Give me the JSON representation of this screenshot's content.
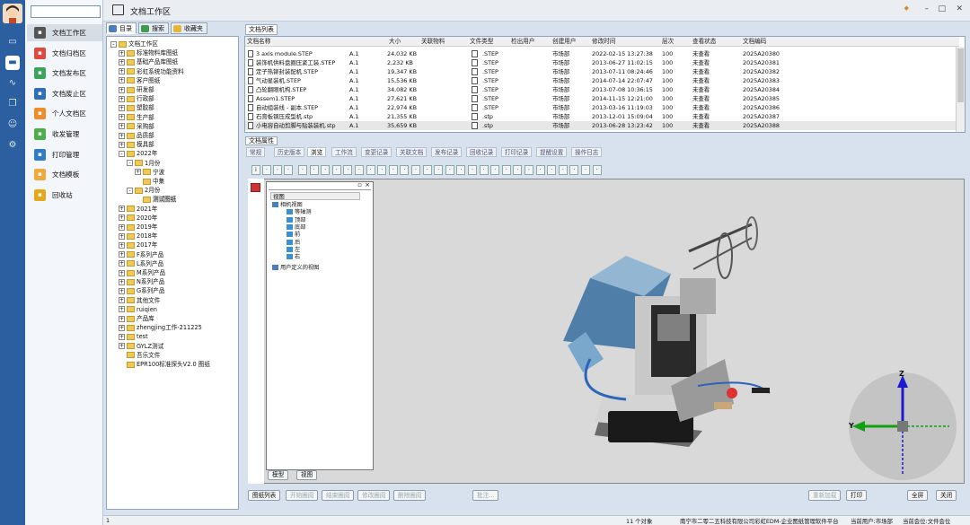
{
  "window": {
    "title": "文档工作区"
  },
  "nav": {
    "search_placeholder": "",
    "items": [
      {
        "label": "文档工作区",
        "icon": "monitor-icon",
        "color": "#555555"
      },
      {
        "label": "文档归档区",
        "icon": "archive-icon",
        "color": "#e0493b"
      },
      {
        "label": "文档发布区",
        "icon": "publish-icon",
        "color": "#3ca55c"
      },
      {
        "label": "文档废止区",
        "icon": "abolish-icon",
        "color": "#2d6fb8"
      },
      {
        "label": "个人文档区",
        "icon": "user-doc-icon",
        "color": "#f08c2a"
      },
      {
        "label": "收发管理",
        "icon": "send-receive-icon",
        "color": "#4cae4c"
      },
      {
        "label": "打印管理",
        "icon": "printer-icon",
        "color": "#2f7cc9"
      },
      {
        "label": "文档模板",
        "icon": "template-icon",
        "color": "#f2a93b"
      },
      {
        "label": "回收站",
        "icon": "recycle-icon",
        "color": "#e8a71a"
      }
    ]
  },
  "left_tabs": [
    "目录",
    "搜索",
    "收藏夹"
  ],
  "tree": [
    {
      "label": "文档工作区",
      "level": 0,
      "toggle": "-"
    },
    {
      "label": "标准物料库图纸",
      "level": 1,
      "toggle": "+"
    },
    {
      "label": "基础产品库图纸",
      "level": 1,
      "toggle": "+"
    },
    {
      "label": "彩虹系统功能资料",
      "level": 1,
      "toggle": "+"
    },
    {
      "label": "客户图纸",
      "level": 1,
      "toggle": "+"
    },
    {
      "label": "研发部",
      "level": 1,
      "toggle": "+"
    },
    {
      "label": "行政部",
      "level": 1,
      "toggle": "+"
    },
    {
      "label": "塑胶部",
      "level": 1,
      "toggle": "+"
    },
    {
      "label": "生产部",
      "level": 1,
      "toggle": "+"
    },
    {
      "label": "采购部",
      "level": 1,
      "toggle": "+"
    },
    {
      "label": "品质部",
      "level": 1,
      "toggle": "+"
    },
    {
      "label": "模具部",
      "level": 1,
      "toggle": "+"
    },
    {
      "label": "2022年",
      "level": 1,
      "toggle": "-"
    },
    {
      "label": "1月份",
      "level": 2,
      "toggle": "-"
    },
    {
      "label": "宁波",
      "level": 3,
      "toggle": "+"
    },
    {
      "label": "中集",
      "level": 3,
      "toggle": ""
    },
    {
      "label": "2月份",
      "level": 2,
      "toggle": "-"
    },
    {
      "label": "测试图纸",
      "level": 3,
      "toggle": "",
      "selected": true
    },
    {
      "label": "2021年",
      "level": 1,
      "toggle": "+"
    },
    {
      "label": "2020年",
      "level": 1,
      "toggle": "+"
    },
    {
      "label": "2019年",
      "level": 1,
      "toggle": "+"
    },
    {
      "label": "2018年",
      "level": 1,
      "toggle": "+"
    },
    {
      "label": "2017年",
      "level": 1,
      "toggle": "+"
    },
    {
      "label": "F系列产品",
      "level": 1,
      "toggle": "+"
    },
    {
      "label": "L系列产品",
      "level": 1,
      "toggle": "+"
    },
    {
      "label": "M系列产品",
      "level": 1,
      "toggle": "+"
    },
    {
      "label": "N系列产品",
      "level": 1,
      "toggle": "+"
    },
    {
      "label": "G系列产品",
      "level": 1,
      "toggle": "+"
    },
    {
      "label": "其他文件",
      "level": 1,
      "toggle": "+"
    },
    {
      "label": "ruiqien",
      "level": 1,
      "toggle": "+"
    },
    {
      "label": "产品库",
      "level": 1,
      "toggle": "+"
    },
    {
      "label": "zhengjing工作-211225",
      "level": 1,
      "toggle": "+"
    },
    {
      "label": "test",
      "level": 1,
      "toggle": "+"
    },
    {
      "label": "GYLZ测试",
      "level": 1,
      "toggle": "+"
    },
    {
      "label": "吾乐文件",
      "level": 1,
      "toggle": ""
    },
    {
      "label": "EPR100标准探头V2.0 图纸",
      "level": 1,
      "toggle": ""
    }
  ],
  "doc_list": {
    "heading": "文档列表",
    "columns": [
      "文档名称",
      "",
      "大小",
      "关联物料",
      "文件类型",
      "检出用户",
      "创建用户",
      "修改时间",
      "层次",
      "查看状态",
      "文档编码"
    ],
    "rows": [
      {
        "name": "3 axis module.STEP",
        "ver": "A.1",
        "size": "24,032 KB",
        "type": ".STEP",
        "creator": "市场部",
        "time": "2022-02-15 13:27:38",
        "level": "100",
        "status": "未查看",
        "code": "2025A20380"
      },
      {
        "name": "装饰机供料盘圈压紧工装.STEP",
        "ver": "A.1",
        "size": "2,232 KB",
        "type": ".STEP",
        "creator": "市场部",
        "time": "2013-06-27 11:02:15",
        "level": "100",
        "status": "未查看",
        "code": "2025A20381"
      },
      {
        "name": "定子热铆封装配机.STEP",
        "ver": "A.1",
        "size": "19,347 KB",
        "type": ".STEP",
        "creator": "市场部",
        "time": "2013-07-11 08:24:46",
        "level": "100",
        "status": "未查看",
        "code": "2025A20382"
      },
      {
        "name": "气动星装机.STEP",
        "ver": "A.1",
        "size": "15,536 KB",
        "type": ".STEP",
        "creator": "市场部",
        "time": "2014-07-14 22:07:47",
        "level": "100",
        "status": "未查看",
        "code": "2025A20383"
      },
      {
        "name": "凸轮翻眼机构.STEP",
        "ver": "A.1",
        "size": "34,082 KB",
        "type": ".STEP",
        "creator": "市场部",
        "time": "2013-07-08 10:36:15",
        "level": "100",
        "status": "未查看",
        "code": "2025A20384"
      },
      {
        "name": "Assem1.STEP",
        "ver": "A.1",
        "size": "27,621 KB",
        "type": ".STEP",
        "creator": "市场部",
        "time": "2014-11-15 12:21:00",
        "level": "100",
        "status": "未查看",
        "code": "2025A20385"
      },
      {
        "name": "自动组装线 - 副本.STEP",
        "ver": "A.1",
        "size": "22,974 KB",
        "type": ".STEP",
        "creator": "市场部",
        "time": "2013-03-16 11:19:03",
        "level": "100",
        "status": "未查看",
        "code": "2025A20386"
      },
      {
        "name": "石膏板钢压成型机.stp",
        "ver": "A.1",
        "size": "21,355 KB",
        "type": ".stp",
        "creator": "市场部",
        "time": "2013-12-01 15:09:04",
        "level": "100",
        "status": "未查看",
        "code": "2025A20387"
      },
      {
        "name": "小电容自动剪脚与贴装装机.stp",
        "ver": "A.1",
        "size": "35,659 KB",
        "type": ".stp",
        "creator": "市场部",
        "time": "2013-06-28 13:23:42",
        "level": "100",
        "status": "未查看",
        "code": "2025A20388",
        "selected": true
      }
    ]
  },
  "props": {
    "heading": "文档属性",
    "tabs": [
      "常规",
      "历史版本",
      "浏览",
      "工作流",
      "变更记录",
      "关联文档",
      "发布记录",
      "回收记录",
      "打印记录",
      "提醒设置",
      "操作日志"
    ],
    "active_tab": 2
  },
  "viewer": {
    "tree_header": "视图",
    "tree": [
      {
        "label": "相机视图",
        "level": 0
      },
      {
        "label": "等轴测",
        "level": 1
      },
      {
        "label": "顶部",
        "level": 1
      },
      {
        "label": "底部",
        "level": 1
      },
      {
        "label": "前",
        "level": 1
      },
      {
        "label": "后",
        "level": 1
      },
      {
        "label": "左",
        "level": 1
      },
      {
        "label": "右",
        "level": 1
      },
      {
        "label": "用户定义的视图",
        "level": 0
      }
    ],
    "bottom_tabs": [
      "模型",
      "视图"
    ],
    "axis": {
      "x": "X",
      "y": "Y",
      "z": "Z"
    }
  },
  "bottom_buttons_left": [
    "图纸列表",
    "开始圈阅",
    "结束圈阅",
    "修改圈阅",
    "删除圈阅",
    "批注..."
  ],
  "bottom_buttons_right": [
    "重新加载",
    "打印",
    "全屏",
    "关闭"
  ],
  "status": {
    "left": "1",
    "count": "11 个对象",
    "company": "南宁市二零二五科技有限公司彩虹EDM-企业图纸管理软件平台",
    "user": "当前用户:市场部",
    "unit": "当前会位:文件会位"
  }
}
